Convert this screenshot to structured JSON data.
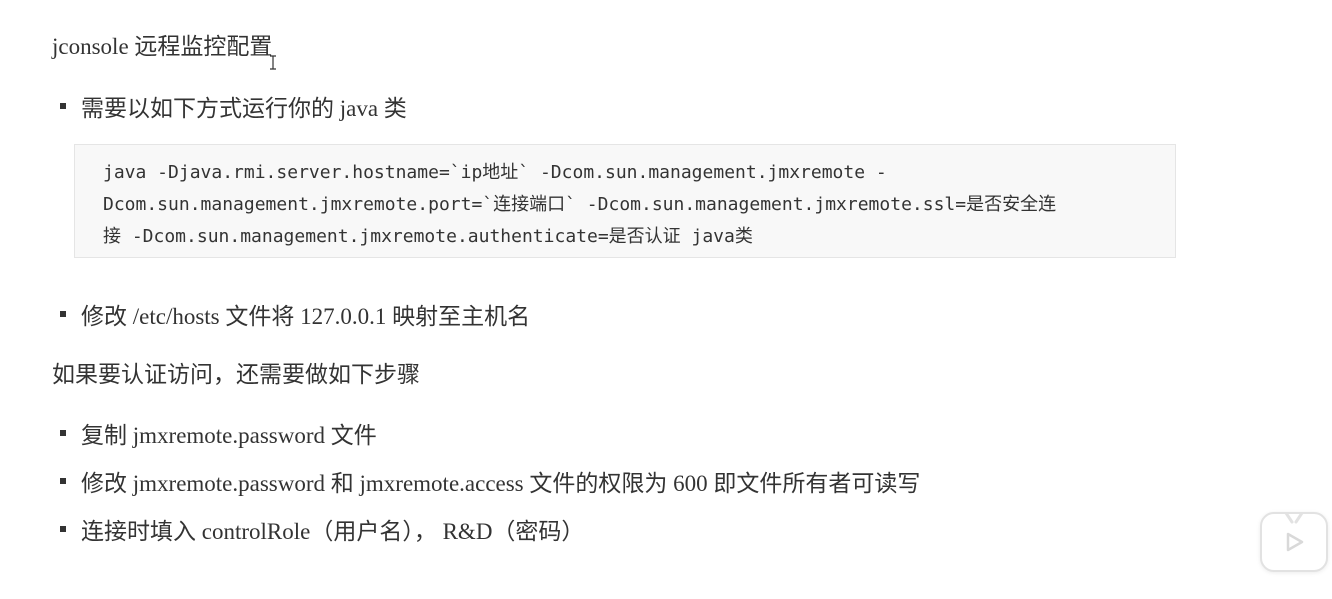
{
  "title": "jconsole 远程监控配置",
  "bullets_top": [
    "需要以如下方式运行你的 java 类"
  ],
  "code": {
    "lines": [
      "java -Djava.rmi.server.hostname=`ip地址` -Dcom.sun.management.jmxremote -",
      "Dcom.sun.management.jmxremote.port=`连接端口` -Dcom.sun.management.jmxremote.ssl=是否安全连",
      "接 -Dcom.sun.management.jmxremote.authenticate=是否认证 java类"
    ]
  },
  "bullets_mid": [
    "修改 /etc/hosts 文件将 127.0.0.1 映射至主机名"
  ],
  "auth_paragraph": "如果要认证访问，还需要做如下步骤",
  "auth_steps": [
    "复制 jmxremote.password 文件",
    "修改 jmxremote.password 和 jmxremote.access 文件的权限为 600 即文件所有者可读写",
    "连接时填入 controlRole（用户名）， R&D（密码）"
  ],
  "icons": {
    "cursor": "text-cursor-icon",
    "player": "play-icon"
  }
}
